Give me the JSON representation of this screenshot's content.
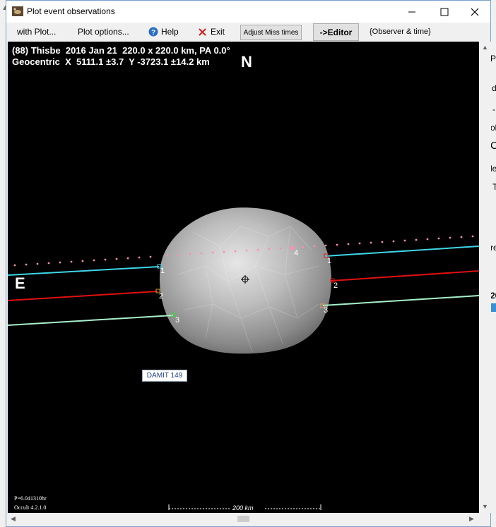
{
  "window": {
    "title": "Plot event observations"
  },
  "menu": {
    "with_plot": "with Plot...",
    "plot_options": "Plot options...",
    "help": "Help",
    "exit": "Exit",
    "adjust_miss": "Adjust Miss times",
    "editor": "->Editor",
    "observer_time": "{Observer & time}"
  },
  "plot": {
    "line1": "(88) Thisbe  2016 Jan 21  220.0 x 220.0 km, PA 0.0°",
    "line2": "Geocentric  X  5111.1 ±3.7  Y -3723.1 ±14.2 km",
    "north": "N",
    "east": "E",
    "model_label": "DAMIT 149",
    "period": "P=6.041310hr",
    "version": "Occult 4.2.1.0",
    "scale": "200 km",
    "chord_labels": [
      "1",
      "2",
      "3",
      "4",
      "1",
      "2",
      "3"
    ]
  },
  "background_window": {
    "letters": [
      "Pl",
      "d",
      "-",
      "ok",
      "C",
      "le",
      "T",
      "re",
      "20"
    ]
  },
  "colors": {
    "chord1": "#3fd6e6",
    "chord2": "#e01010",
    "chord3": "#a8f0c8",
    "predicted": "#ff8fb0",
    "asteroid": "#b8b8b8"
  }
}
